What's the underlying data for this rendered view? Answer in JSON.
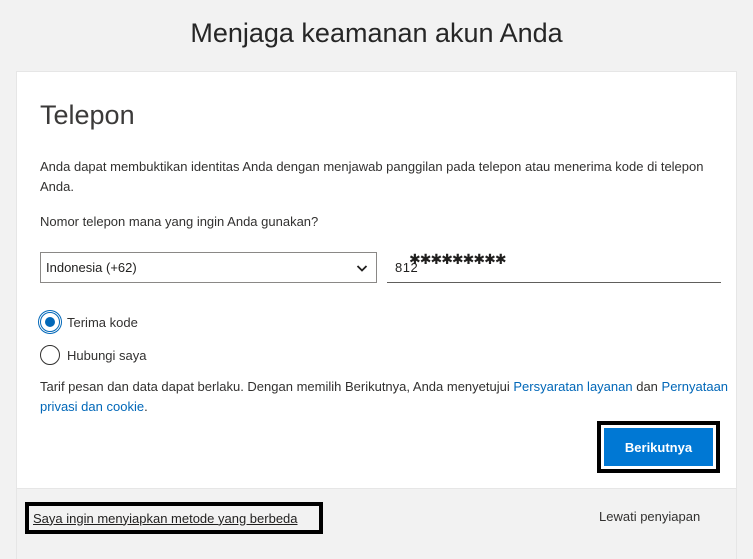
{
  "header": {
    "title": "Menjaga keamanan akun Anda"
  },
  "card": {
    "section_title": "Telepon",
    "description": "Anda dapat membuktikan identitas Anda dengan menjawab panggilan pada telepon atau menerima kode di telepon Anda.",
    "question": "Nomor telepon mana yang ingin Anda gunakan?",
    "country_select": {
      "value": "Indonesia (+62)",
      "icon": "chevron-down-icon"
    },
    "phone_input": {
      "value": "812",
      "masked": "✱✱✱✱✱✱✱✱✱"
    },
    "radio_options": [
      {
        "label": "Terima kode",
        "checked": true
      },
      {
        "label": "Hubungi saya",
        "checked": false
      }
    ],
    "terms": {
      "prefix": "Tarif pesan dan data dapat berlaku. Dengan memilih Berikutnya, Anda menyetujui ",
      "link_terms": "Persyaratan layanan",
      "middle": " dan ",
      "link_privacy": "Pernyataan privasi dan cookie",
      "suffix": "."
    },
    "next_label": "Berikutnya"
  },
  "footer": {
    "alt_method_label": "Saya ingin menyiapkan metode yang berbeda",
    "skip_label": "Lewati penyiapan"
  },
  "colors": {
    "accent": "#0078d4",
    "link": "#0067b8",
    "background": "#f2f2f2"
  }
}
